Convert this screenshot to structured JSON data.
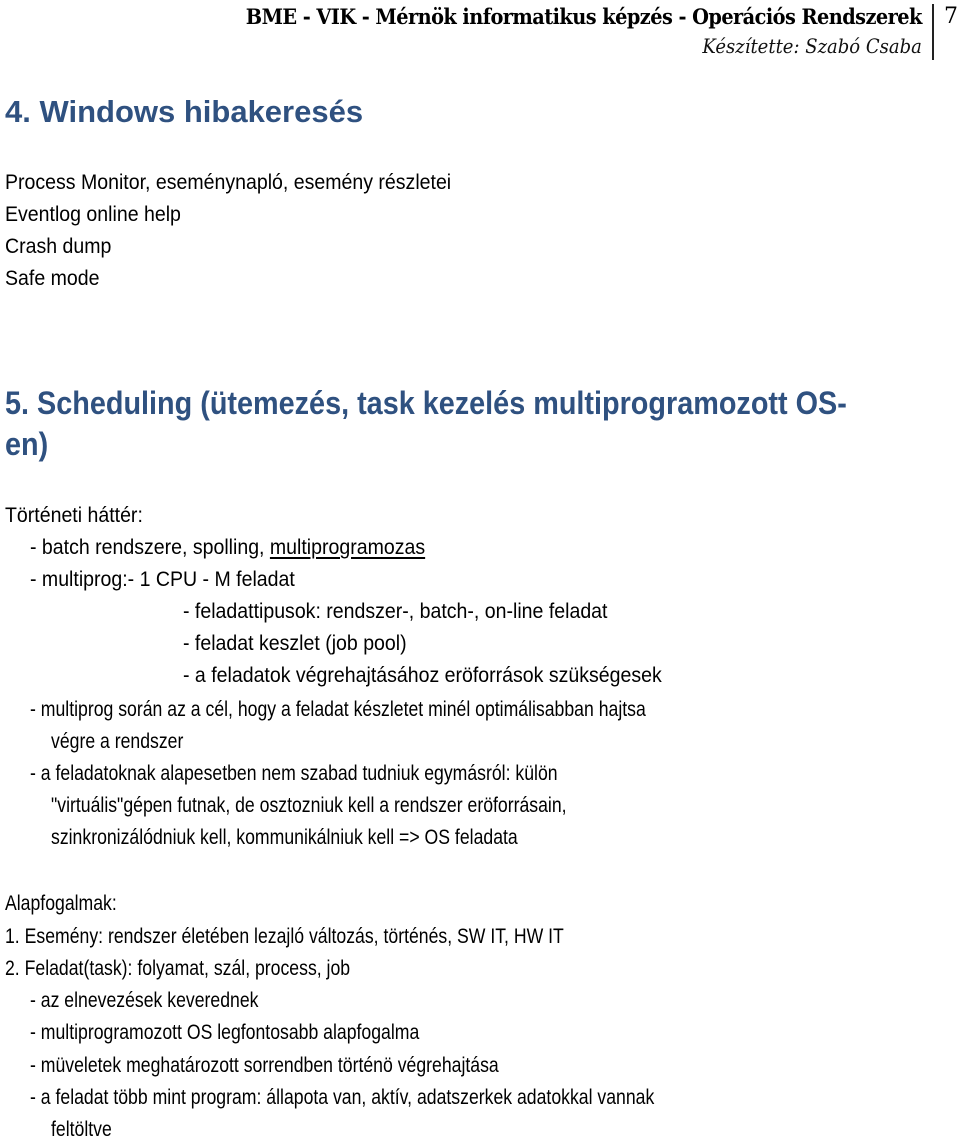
{
  "header": {
    "title": "BME - VIK - Mérnök informatikus képzés - Operációs Rendszerek",
    "author": "Készítette: Szabó Csaba",
    "page_number": "7"
  },
  "section4": {
    "heading": "4. Windows hibakeresés",
    "items": [
      "Process Monitor, eseménynapló, esemény részletei",
      "Eventlog online help",
      "Crash dump",
      "Safe mode"
    ]
  },
  "section5": {
    "heading_line1": "5. Scheduling (ütemezés, task kezelés multiprogramozott OS-",
    "heading_line2": "en)",
    "history": {
      "label": "Történeti háttér:",
      "line1_prefix": "- batch rendszere, spolling, ",
      "line1_underlined": "multiprogramozas",
      "line2": "- multiprog:- 1 CPU - M feladat",
      "sub_items": [
        "- feladattipusok: rendszer-, batch-, on-line feladat",
        "- feladat keszlet (job pool)",
        "- a feladatok végrehajtásához eröforrások szükségesek"
      ],
      "goal_line1": "- multiprog során az a cél, hogy a feladat készletet minél optimálisabban hajtsa",
      "goal_line2": "végre a rendszer",
      "tasks_line1": "- a feladatoknak alapesetben nem szabad tudniuk egymásról: külön",
      "tasks_line2": "\"virtuális\"gépen futnak, de osztozniuk kell a rendszer eröforrásain,",
      "tasks_line3": "szinkronizálódniuk kell, kommunikálniuk kell => OS feladata"
    },
    "basics": {
      "label": "Alapfogalmak:",
      "item1": "1. Esemény: rendszer életében lezajló változás, történés, SW IT, HW IT",
      "item2": "2. Feladat(task):  folyamat, szál, process, job",
      "sub_items": [
        "- az elnevezések keverednek",
        "- multiprogramozott OS legfontosabb alapfogalma",
        "- müveletek meghatározott sorrendben történö végrehajtása",
        "- a feladat több mint program: állapota van, aktív, adatszerkek adatokkal vannak"
      ],
      "last_continuation": "feltöltve"
    }
  }
}
